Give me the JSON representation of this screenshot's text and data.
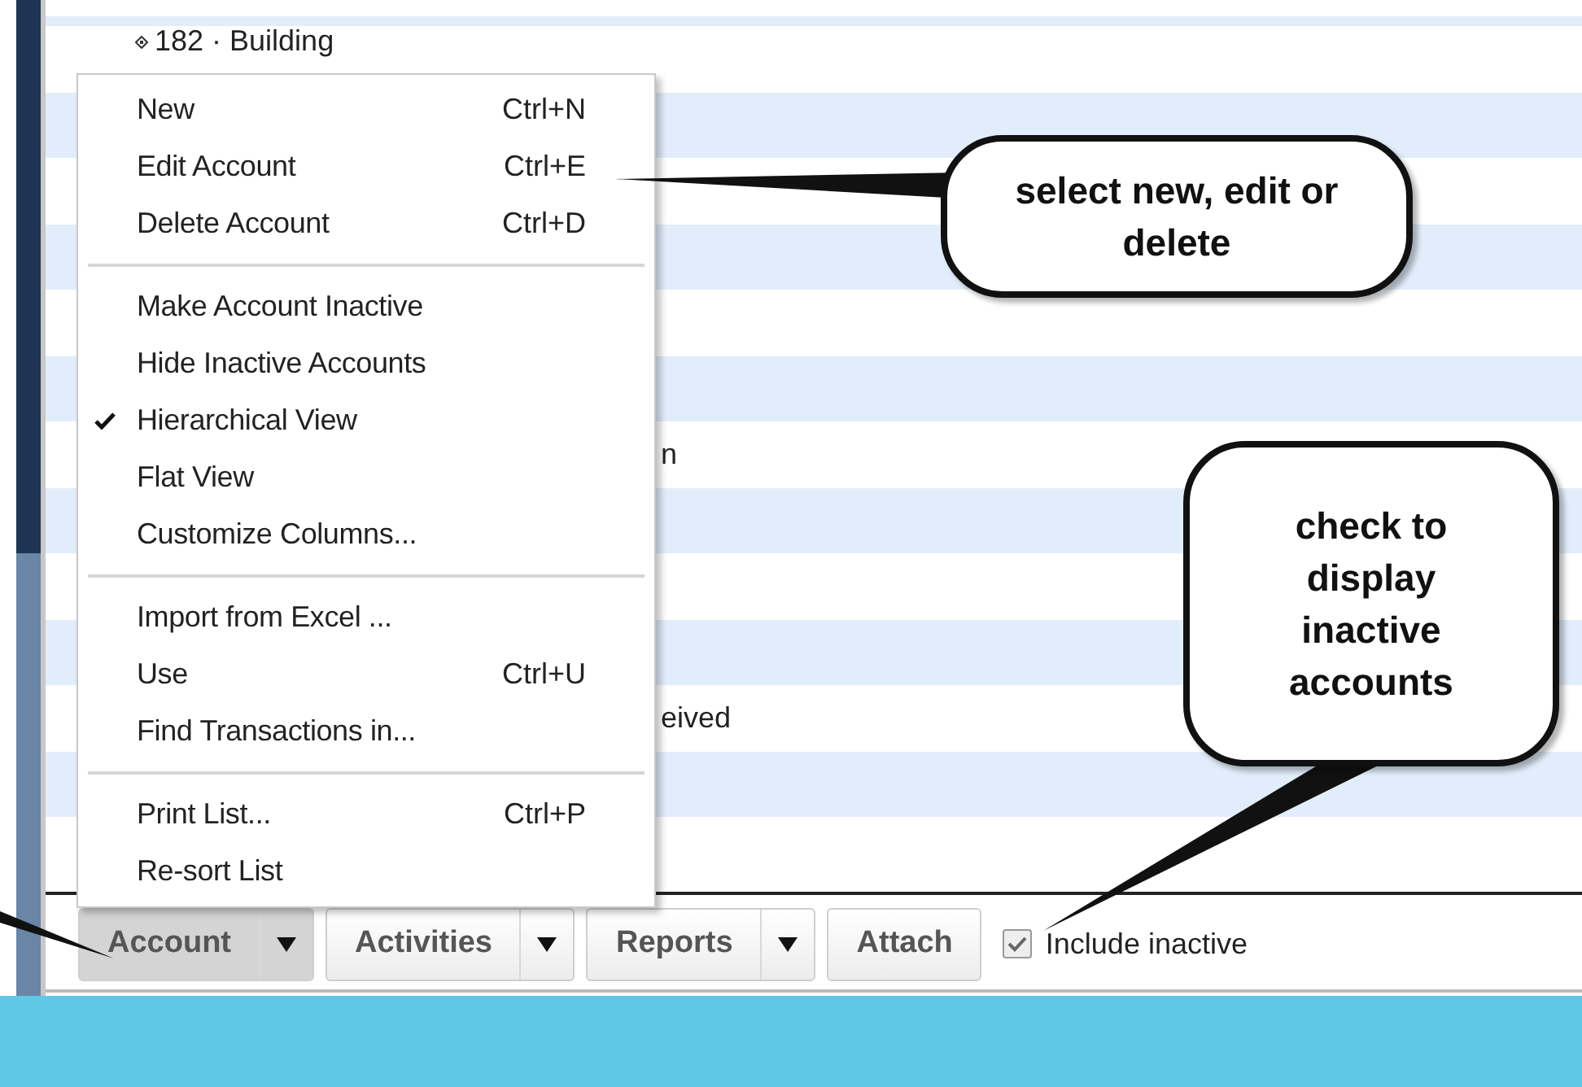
{
  "account_rows": [
    {
      "kind": "subaccount",
      "text": "182 · Building"
    },
    {
      "kind": "partial",
      "text": "n"
    },
    {
      "kind": "partial",
      "text": "eived"
    }
  ],
  "context_menu": {
    "items": [
      {
        "kind": "item",
        "label": "New",
        "shortcut": "Ctrl+N",
        "checked": false
      },
      {
        "kind": "item",
        "label": "Edit Account",
        "shortcut": "Ctrl+E",
        "checked": false
      },
      {
        "kind": "item",
        "label": "Delete Account",
        "shortcut": "Ctrl+D",
        "checked": false
      },
      {
        "kind": "separator"
      },
      {
        "kind": "item",
        "label": "Make Account Inactive",
        "checked": false
      },
      {
        "kind": "item",
        "label": "Hide Inactive Accounts",
        "checked": false
      },
      {
        "kind": "item",
        "label": "Hierarchical View",
        "checked": true
      },
      {
        "kind": "item",
        "label": "Flat View",
        "checked": false
      },
      {
        "kind": "item",
        "label": "Customize Columns...",
        "checked": false
      },
      {
        "kind": "separator"
      },
      {
        "kind": "item",
        "label": "Import from Excel ...",
        "checked": false
      },
      {
        "kind": "item",
        "label": "Use",
        "shortcut": "Ctrl+U",
        "checked": false
      },
      {
        "kind": "item",
        "label": "Find Transactions in...",
        "checked": false
      },
      {
        "kind": "separator"
      },
      {
        "kind": "item",
        "label": "Print List...",
        "shortcut": "Ctrl+P",
        "checked": false
      },
      {
        "kind": "item",
        "label": "Re-sort List",
        "checked": false
      }
    ]
  },
  "toolbar": {
    "buttons": [
      {
        "label": "Account",
        "dropdown": true,
        "pressed": true
      },
      {
        "label": "Activities",
        "dropdown": true,
        "pressed": false
      },
      {
        "label": "Reports",
        "dropdown": true,
        "pressed": false
      },
      {
        "label": "Attach",
        "dropdown": false,
        "pressed": false
      }
    ],
    "include_inactive": {
      "label": "Include inactive",
      "checked": true
    }
  },
  "callouts": [
    {
      "text": "select new, edit or delete"
    },
    {
      "text": "check to display inactive accounts"
    }
  ]
}
